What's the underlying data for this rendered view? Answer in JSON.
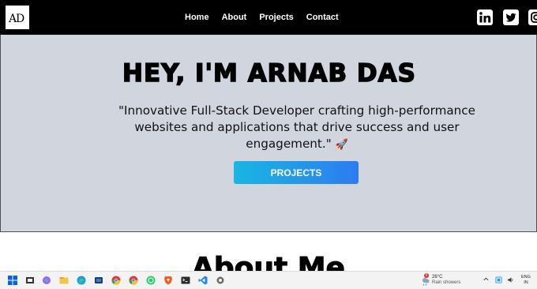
{
  "logo": {
    "text": "AD"
  },
  "nav": {
    "links": [
      "Home",
      "About",
      "Projects",
      "Contact"
    ]
  },
  "social": [
    "linkedin-icon",
    "twitter-icon",
    "instagram-icon"
  ],
  "hero": {
    "title": "HEY, I'M ARNAB DAS",
    "tagline": "\"Innovative Full-Stack Developer crafting high-performance websites and applications that drive success and user engagement.\"",
    "tagline_emoji": "🚀",
    "button_label": "PROJECTS"
  },
  "about": {
    "heading": "About Me"
  },
  "colors": {
    "navbar_bg": "#000000",
    "hero_bg": "#d1d5dd",
    "button_start": "#19b6e3",
    "button_end": "#2d7cf0"
  },
  "taskbar": {
    "apps": [
      "windows-start-icon",
      "widgets-icon",
      "copilot-icon",
      "file-explorer-icon",
      "edge-icon",
      "tv-app-icon",
      "chrome-icon",
      "chrome-alt-icon",
      "whatsapp-icon",
      "brave-icon",
      "terminal-icon",
      "vscode-icon",
      "settings-icon"
    ],
    "weather": {
      "badge": "5",
      "temp": "26°C",
      "desc": "Rain showers"
    },
    "lang_line1": "ENG",
    "lang_line2": "IN"
  }
}
